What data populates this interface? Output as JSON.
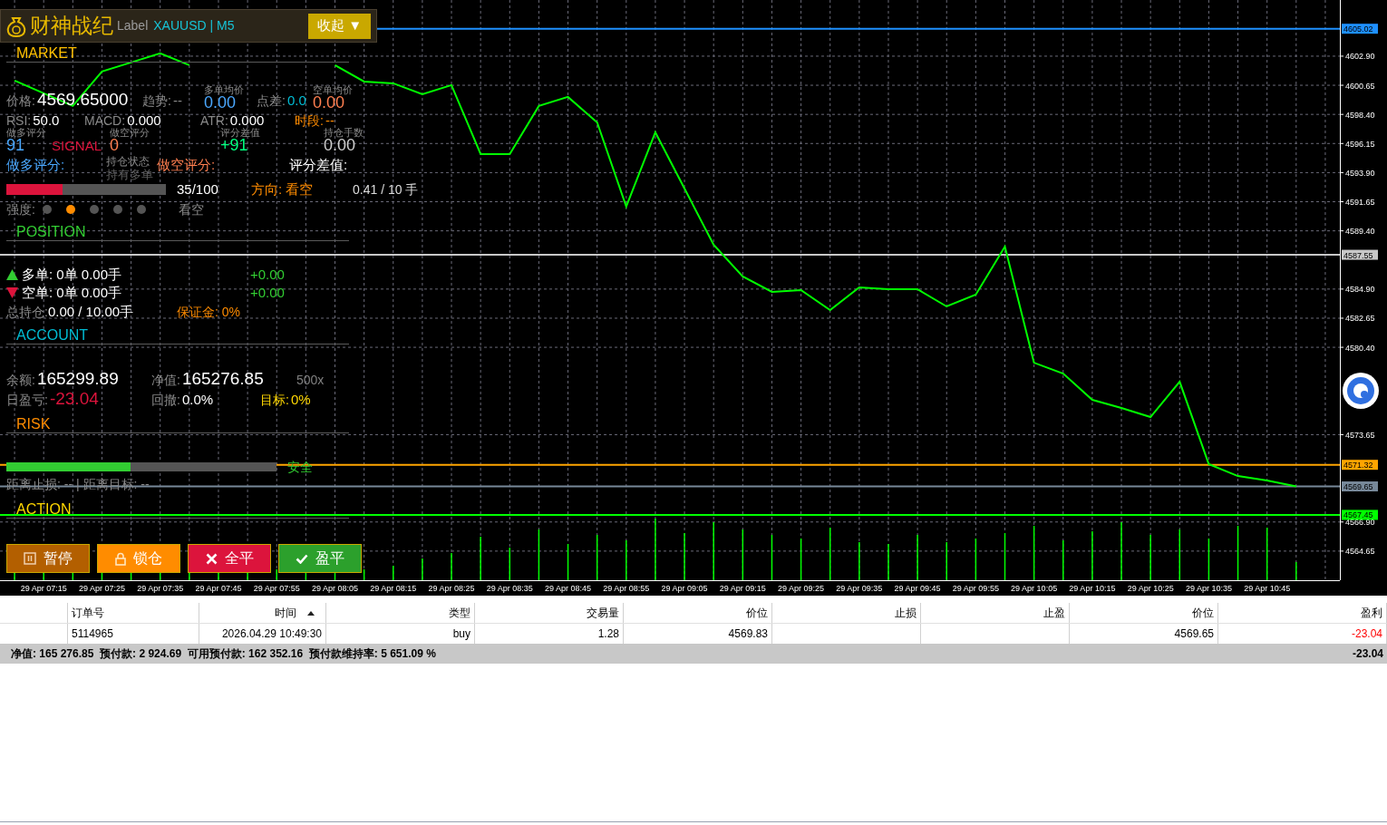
{
  "chart": {
    "chart_data": {
      "type": "line",
      "grid": true,
      "x": [
        null,
        "29 Apr 07:15",
        null,
        "29 Apr 07:25",
        null,
        "29 Apr 07:35",
        null,
        "29 Apr 07:45",
        null,
        "29 Apr 07:55",
        null,
        "29 Apr 08:05",
        null,
        "29 Apr 08:15",
        null,
        "29 Apr 08:25",
        null,
        "29 Apr 08:35",
        null,
        "29 Apr 08:45",
        null,
        "29 Apr 08:55",
        null,
        "29 Apr 09:05",
        null,
        "29 Apr 09:15",
        null,
        "29 Apr 09:25",
        null,
        "29 Apr 09:35",
        null,
        "29 Apr 09:45",
        null,
        "29 Apr 09:55",
        null,
        "29 Apr 10:05",
        null,
        "29 Apr 10:15",
        null,
        "29 Apr 10:25",
        null,
        "29 Apr 10:35",
        null,
        "29 Apr 10:45",
        null,
        null
      ],
      "series": [
        {
          "color": "#00ff00",
          "values": [
            4601.01,
            4600.03,
            4599.05,
            4601.71,
            4602.41,
            4603.11,
            4602.2,
            null,
            null,
            null,
            null,
            4602.2,
            4600.94,
            4600.8,
            4599.96,
            4600.66,
            4595.33,
            4595.33,
            4599.05,
            4599.75,
            4597.78,
            4591.27,
            4597.01,
            4592.67,
            4588.32,
            4585.87,
            4584.68,
            4584.82,
            4583.28,
            4585.03,
            4584.89,
            4584.89,
            4583.56,
            4584.47,
            4588.18,
            4579.21,
            4578.37,
            4576.34,
            4575.71,
            4575.01,
            4577.74,
            4571.37,
            4570.45,
            4570.1,
            4569.65,
            null
          ]
        }
      ],
      "ylim": [
        4562.4,
        4607.24
      ],
      "yticks": [
        {
          "value": 4602.9,
          "label": "4602.90"
        },
        {
          "value": 4600.65,
          "label": "4600.65"
        },
        {
          "value": 4598.4,
          "label": "4598.40"
        },
        {
          "value": 4596.15,
          "label": "4596.15"
        },
        {
          "value": 4593.9,
          "label": "4593.90"
        },
        {
          "value": 4591.65,
          "label": "4591.65"
        },
        {
          "value": 4589.4,
          "label": "4589.40"
        },
        {
          "value": 4584.9,
          "label": "4584.90"
        },
        {
          "value": 4582.65,
          "label": "4582.65"
        },
        {
          "value": 4580.4,
          "label": "4580.40"
        },
        {
          "value": 4573.65,
          "label": "4573.65"
        },
        {
          "value": 4566.9,
          "label": "4566.90"
        },
        {
          "value": 4564.65,
          "label": "4564.65"
        }
      ],
      "ref_lines": [
        {
          "axis": "y",
          "value": 4605.02,
          "label": "4605.02",
          "color": "#1e90ff"
        },
        {
          "axis": "y",
          "value": 4587.55,
          "label": "4587.55",
          "color": "#c8c8c8"
        },
        {
          "axis": "y",
          "value": 4571.32,
          "label": "4571.32",
          "color": "#ffa500"
        },
        {
          "axis": "y",
          "value": 4569.65,
          "label": "4569.65",
          "color": "#778899"
        },
        {
          "axis": "y",
          "value": 4567.45,
          "label": "4567.45",
          "color": "#00ff00"
        }
      ]
    }
  },
  "panel": {
    "title": "财神战纪",
    "label": "Label",
    "symbol": "XAUUSD | M5",
    "collapse_button": "收起 ▼",
    "market": {
      "heading": "MARKET",
      "rows": [
        [
          {
            "kind": "big",
            "label": "价格:",
            "value": "4569.65000",
            "color": "#ffffff"
          },
          {
            "kind": "inline",
            "label": "趋势:",
            "value": "--",
            "color": "#8a8a8a"
          },
          {
            "kind": "stacked",
            "label": "多单均价",
            "value": "0.00",
            "color": "#4aa8ff"
          },
          {
            "kind": "inline",
            "label": "点差:",
            "value": "0.0",
            "color": "#00bcd4"
          },
          {
            "kind": "stacked",
            "label": "空单均价",
            "value": "0.00",
            "color": "#ff7f50"
          }
        ],
        [
          {
            "kind": "inline",
            "label": "RSI:",
            "value": "50.0",
            "color": "#ffffff"
          },
          {
            "kind": "inline",
            "label": "MACD:",
            "value": "0.000",
            "color": "#ffffff"
          },
          {
            "kind": "inline",
            "label": "ATR:",
            "value": "0.000",
            "color": "#ffffff"
          },
          {
            "kind": "tinted",
            "label": "时段:",
            "value": "--",
            "color": "#ff8c00"
          }
        ],
        [
          {
            "kind": "stacked",
            "label": "做多评分",
            "value": "91",
            "color": "#4aa8ff"
          },
          {
            "kind": "stacked",
            "label": "做空评分",
            "value": "0",
            "color": "#ff7f50"
          },
          {
            "kind": "stacked",
            "label": "评分差值",
            "value": "+91",
            "color": "#00ff7f"
          },
          {
            "kind": "stacked",
            "label": "持仓手数",
            "value": "0.00",
            "color": "#d0d0d0"
          }
        ]
      ]
    },
    "signal": {
      "heading": "SIGNAL",
      "score_labels": [
        {
          "text": "做多评分:",
          "color": "#4aa8ff"
        },
        {
          "text": "持仓状态",
          "color": "#8a8a8a"
        },
        {
          "text": "做空评分:",
          "color": "#ff7f50"
        },
        {
          "text": "评分差值:",
          "color": "#ffffff"
        }
      ],
      "score": {
        "level": 0.35,
        "text": "35/100"
      },
      "direction": "方向: 看空",
      "ratio": "0.41 / 10 手",
      "holding": "持有多单",
      "strength_label": "强度:",
      "strength_dots": [
        {
          "selected": false
        },
        {
          "selected": true
        },
        {
          "selected": false
        },
        {
          "selected": false
        },
        {
          "selected": false
        }
      ],
      "bias": "看空"
    },
    "position": {
      "heading": "POSITION",
      "rows": [
        {
          "kind": "long",
          "text": "多单: 0单 0.00手",
          "pnl": "+0.00"
        },
        {
          "kind": "short",
          "text": "空单: 0单 0.00手",
          "pnl": "+0.00"
        }
      ],
      "total_label": "总持仓:",
      "total": "0.00 / 10.00手",
      "margin": "保证金: 0%"
    },
    "account": {
      "heading": "ACCOUNT",
      "rows": [
        [
          {
            "kind": "big",
            "label": "余额:",
            "value": "165299.89",
            "color": "#ffffff"
          },
          {
            "kind": "big",
            "label": "净值:",
            "value": "165276.85",
            "color": "#ffffff"
          },
          {
            "kind": "plain",
            "value": "500x",
            "color": "#808080"
          }
        ],
        [
          {
            "kind": "big",
            "label": "日盈亏:",
            "value": "-23.04",
            "color": "#dc143c"
          },
          {
            "kind": "inline",
            "label": "回撤:",
            "value": "0.0%",
            "color": "#ffffff"
          },
          {
            "kind": "tinted",
            "label": "目标:",
            "value": "0%",
            "color": "#ffd700"
          }
        ]
      ]
    },
    "risk": {
      "heading": "RISK",
      "bar": {
        "level": 0.46
      },
      "status": "安全",
      "distance": "距离止损: -- | 距离目标: --"
    },
    "action": {
      "heading": "ACTION",
      "buttons": [
        {
          "kind": "pause",
          "label": "暂停",
          "color": "#b35f00"
        },
        {
          "kind": "lock",
          "label": "锁仓",
          "color": "#ff8c00"
        },
        {
          "kind": "close",
          "label": "全平",
          "color": "#dc143c"
        },
        {
          "kind": "check",
          "label": "盈平",
          "color": "#2ca02c"
        }
      ]
    }
  },
  "table": {
    "columns": [
      {
        "label": "订单号",
        "sorted": false
      },
      {
        "label": "时间",
        "sorted": true
      },
      {
        "label": "类型",
        "sorted": false
      },
      {
        "label": "交易量",
        "sorted": false
      },
      {
        "label": "价位",
        "sorted": false
      },
      {
        "label": "止损",
        "sorted": false
      },
      {
        "label": "止盈",
        "sorted": false
      },
      {
        "label": "价位",
        "sorted": false
      },
      {
        "label": "盈利",
        "sorted": false,
        "kind": "profit"
      }
    ],
    "rows": [
      {
        "cells": [
          "5114965",
          "2026.04.29 10:49:30",
          "buy",
          "1.28",
          "4569.83",
          "",
          "",
          "4569.65",
          "-23.04"
        ]
      }
    ],
    "summary": {
      "text": "净值: 165 276.85  预付款: 2 924.69  可用预付款: 162 352.16  预付款维持率: 5 651.09 %",
      "total": "-23.04"
    }
  }
}
